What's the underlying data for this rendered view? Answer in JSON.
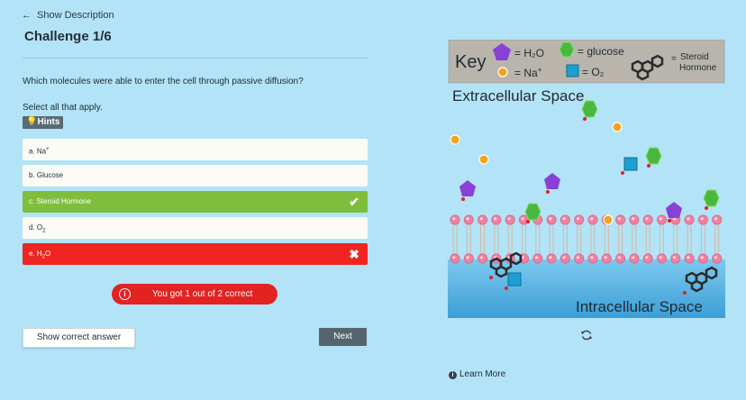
{
  "header": {
    "show_description": "Show Description",
    "challenge_title": "Challenge 1/6"
  },
  "question": {
    "text": "Which molecules were able to enter the cell through passive diffusion?",
    "instruction": "Select all that apply.",
    "hints_label": "Hints"
  },
  "options": [
    {
      "label": "a. Na",
      "sup": "+",
      "sub": "",
      "state": "default"
    },
    {
      "label": "b. Glucose",
      "sup": "",
      "sub": "",
      "state": "default"
    },
    {
      "label": "c. Steroid Hormone",
      "sup": "",
      "sub": "",
      "state": "correct"
    },
    {
      "label": "d. O",
      "sup": "",
      "sub": "2",
      "state": "default"
    },
    {
      "label": "e. H",
      "sup": "",
      "sub": "2",
      "tail": "O",
      "state": "wrong"
    }
  ],
  "feedback": {
    "message": "You got 1 out of 2 correct",
    "color": "#e32222"
  },
  "buttons": {
    "show_correct": "Show correct answer",
    "next": "Next"
  },
  "simulation": {
    "key_title": "Key",
    "key_h2o": "= H₂O",
    "key_glucose": "= glucose",
    "key_na": "= Na",
    "key_na_sup": "+",
    "key_o2": "= O₂",
    "key_steroid_line1": "Steroid",
    "key_steroid_line2": "Hormone",
    "key_steroid_eq": "=",
    "extracellular_label": "Extracellular Space",
    "intracellular_label": "Intracellular Space",
    "colors": {
      "h2o": "#8a3fd6",
      "glucose": "#49b83c",
      "na": "#f5a21c",
      "o2": "#1d9fd0",
      "membrane_head": "#f07fa0",
      "intracellular": "#4baae0"
    }
  },
  "footer": {
    "learn_more": "Learn More"
  },
  "icons": {
    "back": "arrow-left-icon",
    "hint": "lightbulb-icon",
    "check": "checkmark-icon",
    "close": "x-icon",
    "info": "info-icon",
    "reset": "refresh-icon"
  }
}
